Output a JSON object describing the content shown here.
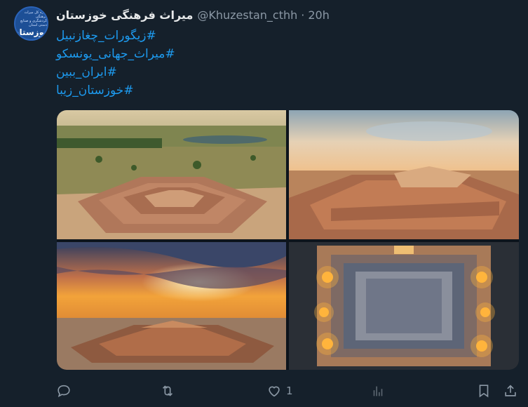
{
  "tweet": {
    "avatar": {
      "lines": [
        "اداره کل میراث فرهنگی",
        "گردشگری و صنایع دستی استان"
      ],
      "title": "خوزستان"
    },
    "author_name": "میراث فرهنگی خوزستان",
    "handle": "@Khuzestan_cthh",
    "separator": "·",
    "time": "20h",
    "hashtags": [
      "#زیگورات_چغازنبیل",
      "#میراث_جهانی_یونسکو",
      "#ایران_ببین",
      "#خوزستان_زیبا"
    ],
    "media": [
      {
        "name": "ziggurat-aerial-day"
      },
      {
        "name": "ziggurat-sunset-side"
      },
      {
        "name": "ziggurat-sunburst"
      },
      {
        "name": "ziggurat-night-top-view"
      }
    ],
    "actions": {
      "reply": {
        "icon": "reply-icon"
      },
      "retweet": {
        "icon": "retweet-icon"
      },
      "like": {
        "icon": "heart-icon",
        "count": "1"
      },
      "views": {
        "icon": "views-icon"
      },
      "bookmark": {
        "icon": "bookmark-icon"
      },
      "share": {
        "icon": "share-icon"
      }
    }
  },
  "colors": {
    "background": "#15202b",
    "link": "#1d9bf0",
    "muted": "#8b98a5",
    "text": "#e7e9ea"
  }
}
